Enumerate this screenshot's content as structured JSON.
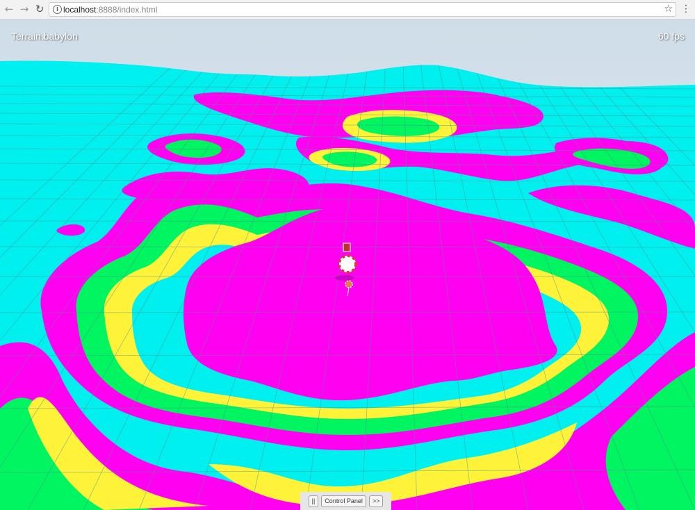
{
  "browser": {
    "back_icon": "back-arrow-icon",
    "forward_icon": "forward-arrow-icon",
    "reload_icon": "reload-icon",
    "url_host": "localhost",
    "url_rest": ":8888/index.html",
    "bookmark_icon": "star-icon",
    "menu_icon": "kebab-menu-icon"
  },
  "scene": {
    "title": "Terrain.babylon",
    "fps": "60 fps",
    "colors": {
      "sky_top": "#cfdde8",
      "sky_bottom": "#e9f0f5",
      "cyan": "#00f0f0",
      "magenta": "#ff00f0",
      "yellow": "#fff33a",
      "green": "#00f560",
      "grid": "#4c8f8f"
    }
  },
  "control_panel": {
    "pause_label": "||",
    "panel_label": "Control Panel",
    "next_label": ">>"
  }
}
